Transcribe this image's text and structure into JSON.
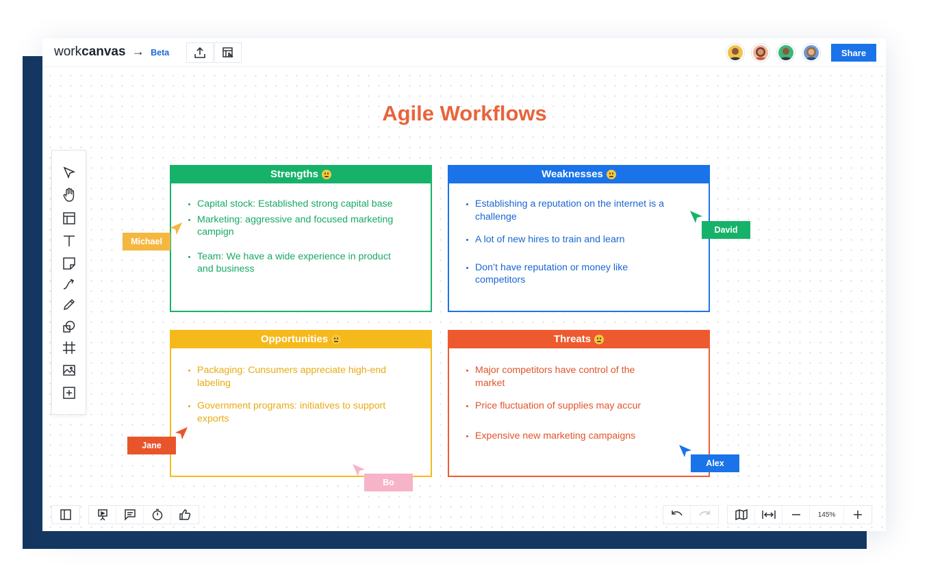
{
  "app": {
    "logo_light": "work",
    "logo_bold": "canvas",
    "logo_arrow": "→",
    "beta": "Beta",
    "share_label": "Share"
  },
  "toolbar_top": {
    "icons": [
      "upload-icon",
      "board-select-icon"
    ]
  },
  "collaborators": [
    {
      "name": "avatar-1",
      "bg": "#f2c24a",
      "skin": "#8a5a3a"
    },
    {
      "name": "avatar-2",
      "bg": "#f0b7a0",
      "skin": "#c98a6a"
    },
    {
      "name": "avatar-3",
      "bg": "#3cb67a",
      "skin": "#8a5a3a"
    },
    {
      "name": "avatar-4",
      "bg": "#6b9bd6",
      "skin": "#d9a07a"
    }
  ],
  "board": {
    "title": "Agile Workflows"
  },
  "tools": [
    "pointer-icon",
    "hand-icon",
    "template-icon",
    "text-icon",
    "sticky-note-icon",
    "connector-icon",
    "pencil-icon",
    "shapes-icon",
    "frame-icon",
    "image-icon",
    "add-icon"
  ],
  "swot": {
    "strengths": {
      "title": "Strengths",
      "color": "#17b26a",
      "items": [
        "Capital stock: Established strong capital base",
        "Marketing: aggressive and focused marketing campign",
        "Team: We have a wide experience in product and business"
      ]
    },
    "weaknesses": {
      "title": "Weaknesses",
      "color": "#1a73e8",
      "items": [
        "Establishing a reputation on the internet is a challenge",
        "A lot of new hires to train and learn",
        "Don’t have reputation or money like competitors"
      ]
    },
    "opportunities": {
      "title": "Opportunities",
      "color": "#f6b91c",
      "items": [
        "Packaging: Cunsumers appreciate high-end labeling",
        "Government programs: initiatives to support exports"
      ]
    },
    "threats": {
      "title": "Threats",
      "color": "#ee5a2f",
      "items": [
        "Major competitors have control of the market",
        "Price fluctuation of supplies may accur",
        "Expensive new marketing campaigns"
      ]
    }
  },
  "cursors": {
    "michael": {
      "label": "Michael",
      "color": "#f4b740"
    },
    "david": {
      "label": "David",
      "color": "#17b26a"
    },
    "jane": {
      "label": "Jane",
      "color": "#e9552b"
    },
    "bo": {
      "label": "Bo",
      "color": "#f7b4c8"
    },
    "alex": {
      "label": "Alex",
      "color": "#1a73e8"
    }
  },
  "bottombar": {
    "zoom": "145%"
  }
}
